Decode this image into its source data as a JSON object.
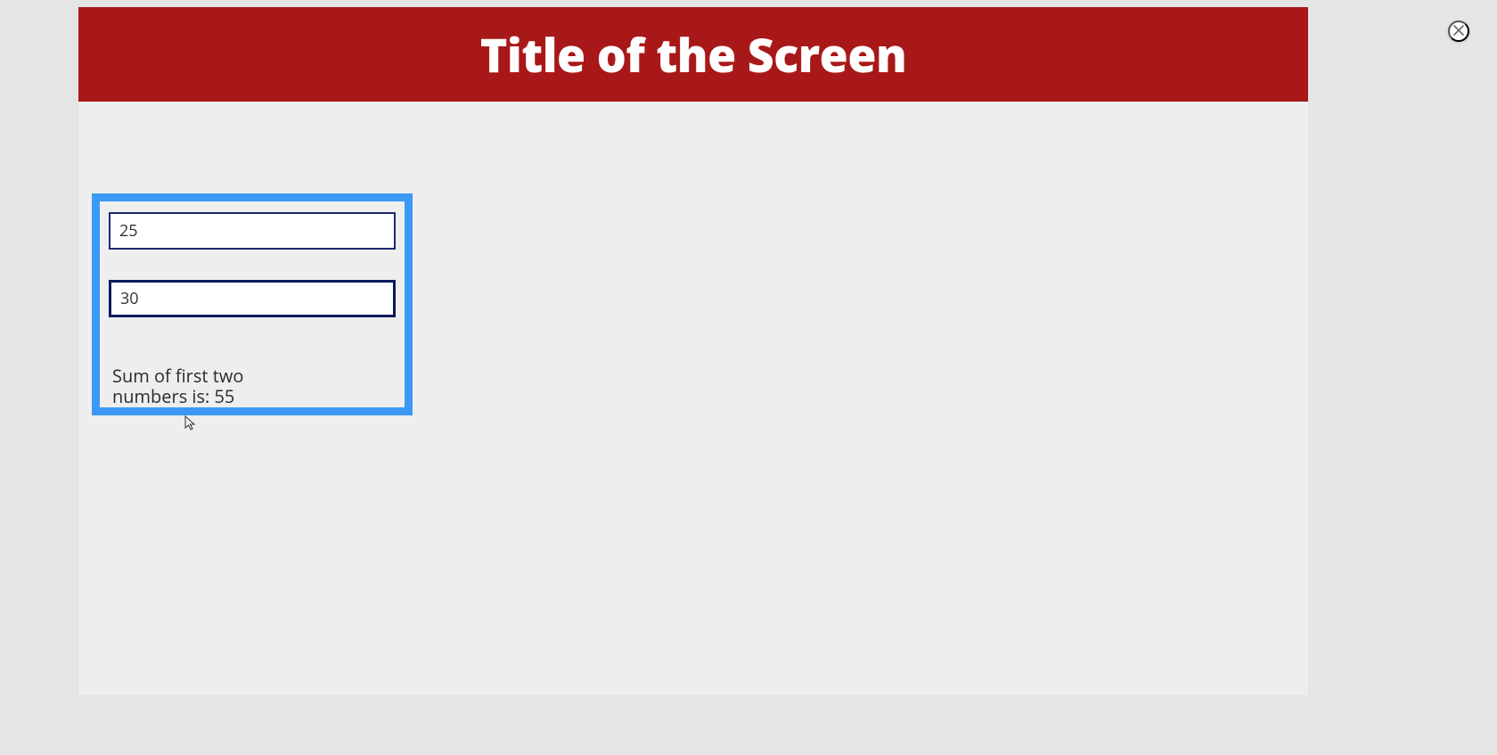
{
  "header": {
    "title": "Title of the Screen"
  },
  "card": {
    "input1_value": "25",
    "input2_value": "30",
    "result_text": "Sum of first two numbers is: 55"
  },
  "colors": {
    "accent": "#a91818",
    "highlight": "#3b99f5",
    "input_border": "#1a2a6c"
  }
}
